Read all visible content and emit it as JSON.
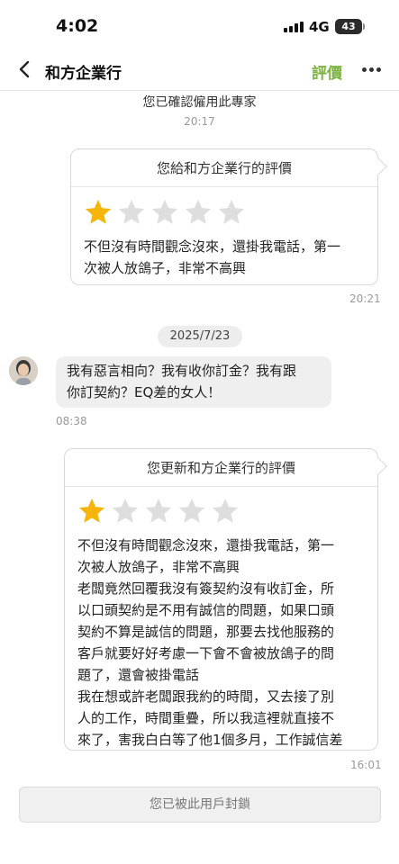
{
  "status_bar": {
    "time": "4:02",
    "network": "4G",
    "battery": "43"
  },
  "nav": {
    "title": "和方企業行",
    "rate_label": "評價"
  },
  "messages": {
    "hire_confirm": "您已確認僱用此專家",
    "hire_time": "20:17",
    "review1": {
      "header": "您給和方企業行的評價",
      "rating": 1,
      "max_rating": 5,
      "text": "不但沒有時間觀念沒來，還掛我電話，第一\n次被人放鴿子，非常不高興",
      "time": "20:21"
    },
    "date_divider": "2025/7/23",
    "incoming": {
      "text": "我有惡言相向？我有收你訂金？我有跟\n你訂契約？EQ差的女人！",
      "time": "08:38"
    },
    "review2": {
      "header": "您更新和方企業行的評價",
      "rating": 1,
      "max_rating": 5,
      "text": "不但沒有時間觀念沒來，還掛我電話，第一\n次被人放鴿子，非常不高興\n老闆竟然回覆我沒有簽契約沒有收訂金，所\n以口頭契約是不用有誠信的問題，如果口頭\n契約不算是誠信的問題，那要去找他服務的\n客戶就要好好考慮一下會不會被放鴿子的問\n題了，還會被掛電話\n我在想或許老闆跟我約的時間，又去接了別\n人的工作，時間重疊，所以我這裡就直接不\n來了，害我白白等了他1個多月，工作誠信差",
      "time": "16:01"
    }
  },
  "footer": {
    "blocked_text": "您已被此用戶封鎖"
  },
  "colors": {
    "accent": "#7cb342",
    "star_filled": "#f5b50a",
    "star_empty": "#dedede"
  }
}
